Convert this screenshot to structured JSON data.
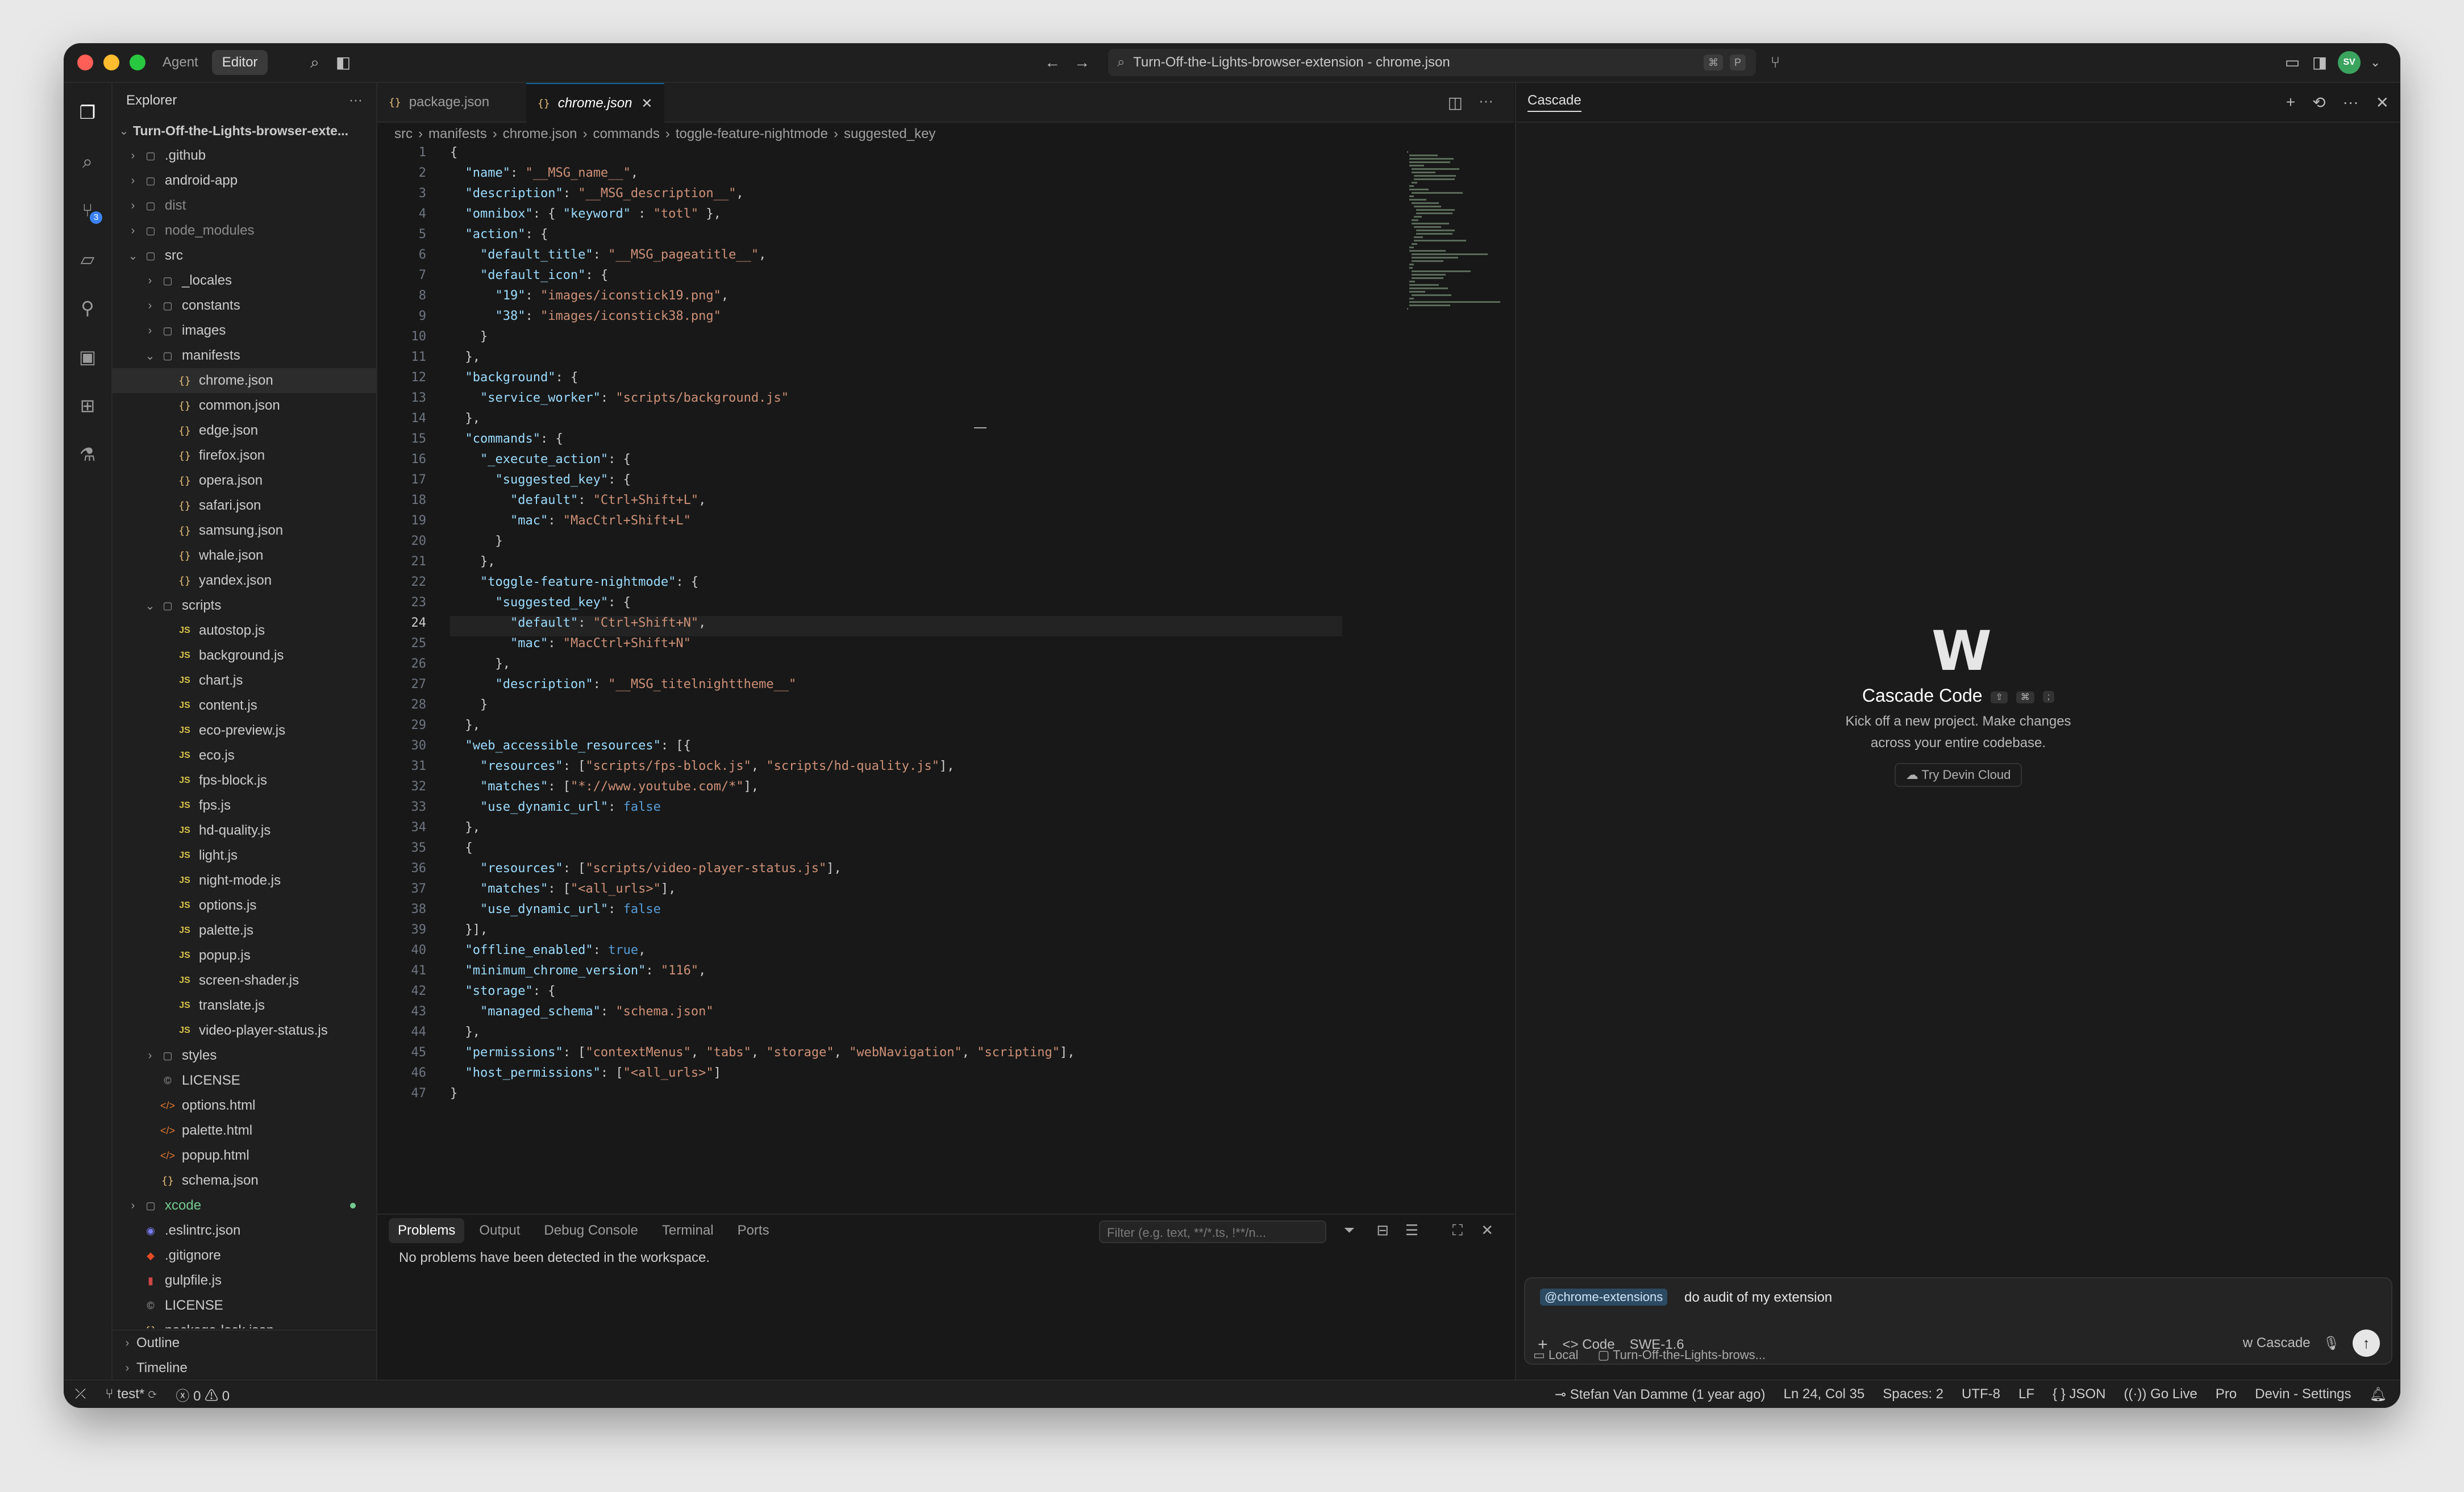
{
  "window": {
    "mode_tabs": [
      "Agent",
      "Editor"
    ],
    "command_center": "Turn-Off-the-Lights-browser-extension - chrome.json",
    "shortcut_keys": [
      "⌘",
      "P"
    ],
    "avatar_initials": "SV"
  },
  "explorer": {
    "title": "Explorer",
    "root": "Turn-Off-the-Lights-browser-exte...",
    "items": [
      {
        "label": ".github",
        "type": "folder",
        "depth": 0,
        "chev": "›"
      },
      {
        "label": "android-app",
        "type": "folder",
        "depth": 0,
        "chev": "›"
      },
      {
        "label": "dist",
        "type": "folder",
        "depth": 0,
        "chev": "›",
        "dim": true
      },
      {
        "label": "node_modules",
        "type": "folder",
        "depth": 0,
        "chev": "›",
        "dim": true
      },
      {
        "label": "src",
        "type": "folder",
        "depth": 0,
        "chev": "⌄"
      },
      {
        "label": "_locales",
        "type": "folder",
        "depth": 1,
        "chev": "›"
      },
      {
        "label": "constants",
        "type": "folder",
        "depth": 1,
        "chev": "›"
      },
      {
        "label": "images",
        "type": "folder",
        "depth": 1,
        "chev": "›"
      },
      {
        "label": "manifests",
        "type": "folder",
        "depth": 1,
        "chev": "⌄"
      },
      {
        "label": "chrome.json",
        "type": "json",
        "depth": 2,
        "selected": true
      },
      {
        "label": "common.json",
        "type": "json",
        "depth": 2
      },
      {
        "label": "edge.json",
        "type": "json",
        "depth": 2
      },
      {
        "label": "firefox.json",
        "type": "json",
        "depth": 2
      },
      {
        "label": "opera.json",
        "type": "json",
        "depth": 2
      },
      {
        "label": "safari.json",
        "type": "json",
        "depth": 2
      },
      {
        "label": "samsung.json",
        "type": "json",
        "depth": 2
      },
      {
        "label": "whale.json",
        "type": "json",
        "depth": 2
      },
      {
        "label": "yandex.json",
        "type": "json",
        "depth": 2
      },
      {
        "label": "scripts",
        "type": "folder",
        "depth": 1,
        "chev": "⌄"
      },
      {
        "label": "autostop.js",
        "type": "js",
        "depth": 2
      },
      {
        "label": "background.js",
        "type": "js",
        "depth": 2
      },
      {
        "label": "chart.js",
        "type": "js",
        "depth": 2
      },
      {
        "label": "content.js",
        "type": "js",
        "depth": 2
      },
      {
        "label": "eco-preview.js",
        "type": "js",
        "depth": 2
      },
      {
        "label": "eco.js",
        "type": "js",
        "depth": 2
      },
      {
        "label": "fps-block.js",
        "type": "js",
        "depth": 2
      },
      {
        "label": "fps.js",
        "type": "js",
        "depth": 2
      },
      {
        "label": "hd-quality.js",
        "type": "js",
        "depth": 2
      },
      {
        "label": "light.js",
        "type": "js",
        "depth": 2
      },
      {
        "label": "night-mode.js",
        "type": "js",
        "depth": 2
      },
      {
        "label": "options.js",
        "type": "js",
        "depth": 2
      },
      {
        "label": "palette.js",
        "type": "js",
        "depth": 2
      },
      {
        "label": "popup.js",
        "type": "js",
        "depth": 2
      },
      {
        "label": "screen-shader.js",
        "type": "js",
        "depth": 2
      },
      {
        "label": "translate.js",
        "type": "js",
        "depth": 2
      },
      {
        "label": "video-player-status.js",
        "type": "js",
        "depth": 2
      },
      {
        "label": "styles",
        "type": "folder",
        "depth": 1,
        "chev": "›"
      },
      {
        "label": "LICENSE",
        "type": "lic",
        "depth": 1
      },
      {
        "label": "options.html",
        "type": "html",
        "depth": 1
      },
      {
        "label": "palette.html",
        "type": "html",
        "depth": 1
      },
      {
        "label": "popup.html",
        "type": "html",
        "depth": 1
      },
      {
        "label": "schema.json",
        "type": "json",
        "depth": 1
      },
      {
        "label": "xcode",
        "type": "folder",
        "depth": 0,
        "chev": "›",
        "green": true,
        "dot": true
      },
      {
        "label": ".eslintrc.json",
        "type": "eslint",
        "depth": 0
      },
      {
        "label": ".gitignore",
        "type": "git",
        "depth": 0
      },
      {
        "label": "gulpfile.js",
        "type": "gulp",
        "depth": 0
      },
      {
        "label": "LICENSE",
        "type": "lic",
        "depth": 0
      },
      {
        "label": "package-lock.json",
        "type": "json",
        "depth": 0
      }
    ],
    "outline": "Outline",
    "timeline": "Timeline"
  },
  "editor": {
    "tabs": [
      {
        "label": "package.json",
        "active": false
      },
      {
        "label": "chrome.json",
        "active": true
      }
    ],
    "close_glyph": "✕",
    "breadcrumb": [
      "src",
      "manifests",
      "chrome.json",
      "commands",
      "toggle-feature-nightmode",
      "suggested_key"
    ],
    "current_line": 24,
    "lines": [
      "{",
      "  \"name\": \"__MSG_name__\",",
      "  \"description\": \"__MSG_description__\",",
      "  \"omnibox\": { \"keyword\" : \"totl\" },",
      "  \"action\": {",
      "    \"default_title\": \"__MSG_pageatitle__\",",
      "    \"default_icon\": {",
      "      \"19\": \"images/iconstick19.png\",",
      "      \"38\": \"images/iconstick38.png\"",
      "    }",
      "  },",
      "  \"background\": {",
      "    \"service_worker\": \"scripts/background.js\"",
      "  },",
      "  \"commands\": {",
      "    \"_execute_action\": {",
      "      \"suggested_key\": {",
      "        \"default\": \"Ctrl+Shift+L\",",
      "        \"mac\": \"MacCtrl+Shift+L\"",
      "      }",
      "    },",
      "    \"toggle-feature-nightmode\": {",
      "      \"suggested_key\": {",
      "        \"default\": \"Ctrl+Shift+N\",",
      "        \"mac\": \"MacCtrl+Shift+N\"",
      "      },",
      "      \"description\": \"__MSG_titelnighttheme__\"",
      "    }",
      "  },",
      "  \"web_accessible_resources\": [{",
      "    \"resources\": [\"scripts/fps-block.js\", \"scripts/hd-quality.js\"],",
      "    \"matches\": [\"*://www.youtube.com/*\"],",
      "    \"use_dynamic_url\": false",
      "  },",
      "  {",
      "    \"resources\": [\"scripts/video-player-status.js\"],",
      "    \"matches\": [\"<all_urls>\"],",
      "    \"use_dynamic_url\": false",
      "  }],",
      "  \"offline_enabled\": true,",
      "  \"minimum_chrome_version\": \"116\",",
      "  \"storage\": {",
      "    \"managed_schema\": \"schema.json\"",
      "  },",
      "  \"permissions\": [\"contextMenus\", \"tabs\", \"storage\", \"webNavigation\", \"scripting\"],",
      "  \"host_permissions\": [\"<all_urls>\"]",
      "}"
    ]
  },
  "panel": {
    "tabs": [
      "Problems",
      "Output",
      "Debug Console",
      "Terminal",
      "Ports"
    ],
    "filter_placeholder": "Filter (e.g. text, **/*.ts, !**/n...",
    "message": "No problems have been detected in the workspace."
  },
  "cascade": {
    "title": "Cascade",
    "hero_title": "Cascade Code",
    "hero_keys": [
      "⇧",
      "⌘",
      ";"
    ],
    "hero_sub_1": "Kick off a new project. Make changes",
    "hero_sub_2": "across your entire codebase.",
    "try_button": "Try Devin Cloud",
    "mention": "@chrome-extensions",
    "prompt": "do audit of my extension",
    "mode": "Code",
    "model": "SWE-1.6",
    "cascade_label": "Cascade",
    "local": "Local",
    "workspace": "Turn-Off-the-Lights-brows..."
  },
  "status": {
    "branch": "test*",
    "errors": "0",
    "warnings": "0",
    "blame": "Stefan Van Damme (1 year ago)",
    "position": "Ln 24, Col 35",
    "spaces": "Spaces: 2",
    "encoding": "UTF-8",
    "eol": "LF",
    "language": "JSON",
    "golive": "Go Live",
    "pro": "Pro",
    "devin": "Devin - Settings"
  }
}
